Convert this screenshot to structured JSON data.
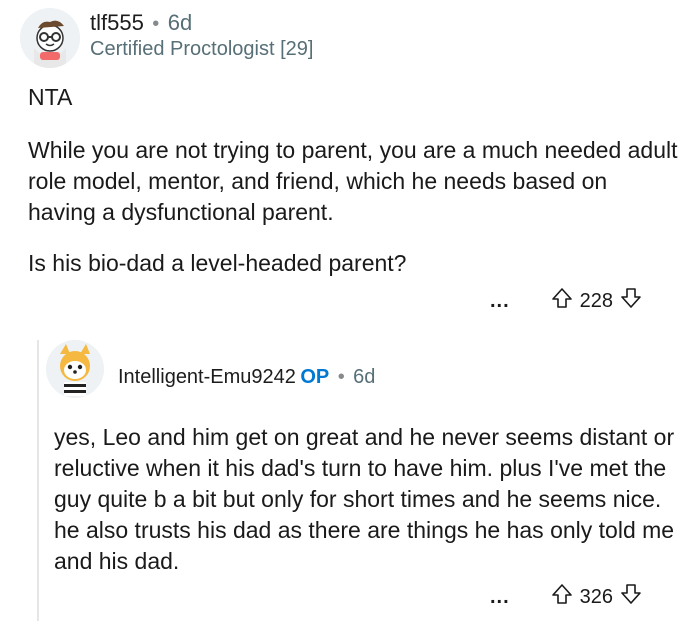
{
  "parent": {
    "username": "tlf555",
    "age": "6d",
    "flair": "Certified Proctologist [29]",
    "paragraphs": [
      "NTA",
      "While you are not trying to parent, you are a much needed adult role model, mentor, and friend, which he needs based on having a dysfunctional parent.",
      "Is his bio-dad a level-headed parent?"
    ],
    "votes": "228",
    "more_label": "..."
  },
  "reply": {
    "username": "Intelligent-Emu9242",
    "op_label": "OP",
    "age": "6d",
    "paragraphs": [
      "yes, Leo and him get on great and he never seems distant or reluctive when it his dad's turn to have him. plus I've met the guy quite b a bit but only for short times and he seems nice. he also trusts his dad as there are things he has only told me and his dad."
    ],
    "votes": "326",
    "more_label": "..."
  },
  "icons": {
    "upvote": "arrow-up-outline-icon",
    "downvote": "arrow-down-outline-icon",
    "more": "ellipsis-icon"
  }
}
